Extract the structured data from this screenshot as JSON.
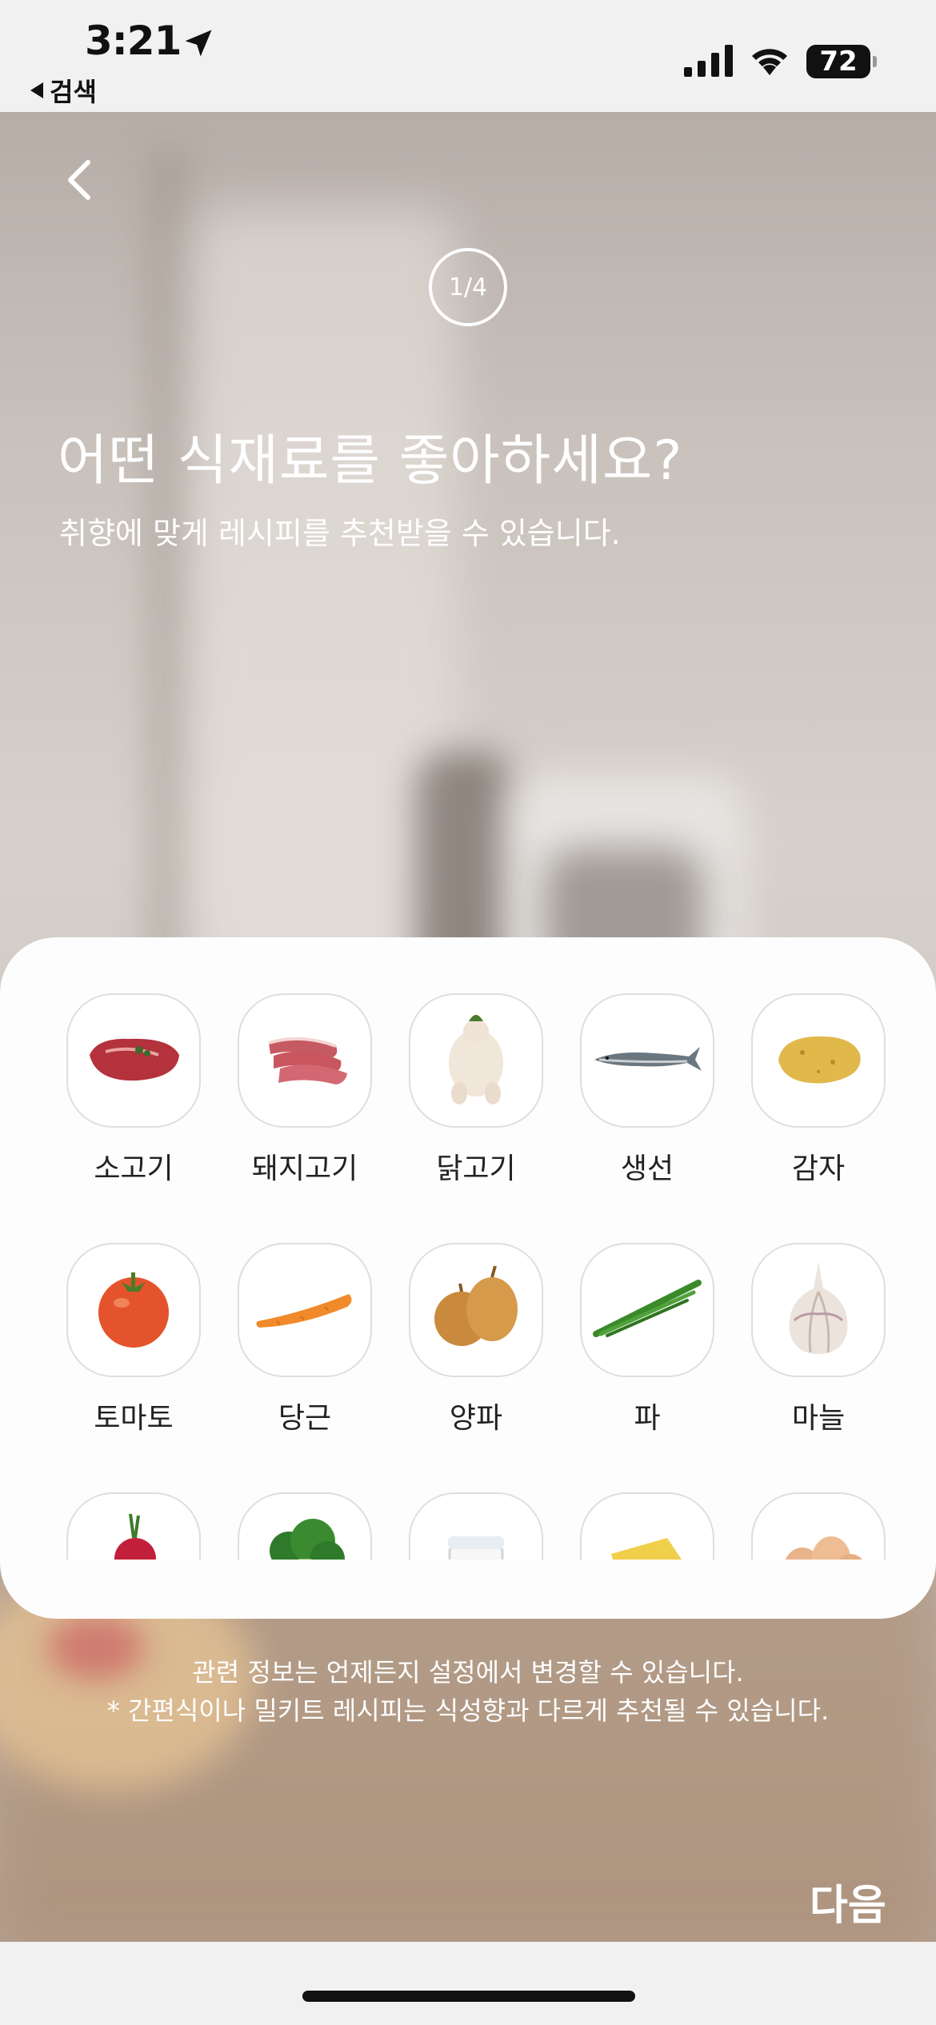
{
  "status_bar": {
    "time": "3:21",
    "back_app_label": "검색",
    "battery_level": "72"
  },
  "header": {
    "step": "1/4",
    "title": "어떤 식재료를 좋아하세요?",
    "subtitle": "취향에 맞게 레시피를 추천받을 수 있습니다."
  },
  "ingredients": [
    {
      "label": "소고기",
      "icon": "beef-icon"
    },
    {
      "label": "돼지고기",
      "icon": "pork-icon"
    },
    {
      "label": "닭고기",
      "icon": "chicken-icon"
    },
    {
      "label": "생선",
      "icon": "fish-icon"
    },
    {
      "label": "감자",
      "icon": "potato-icon"
    },
    {
      "label": "토마토",
      "icon": "tomato-icon"
    },
    {
      "label": "당근",
      "icon": "carrot-icon"
    },
    {
      "label": "양파",
      "icon": "onion-icon"
    },
    {
      "label": "파",
      "icon": "green-onion-icon"
    },
    {
      "label": "마늘",
      "icon": "garlic-icon"
    },
    {
      "label": "",
      "icon": "radish-icon"
    },
    {
      "label": "",
      "icon": "broccoli-icon"
    },
    {
      "label": "",
      "icon": "yogurt-icon"
    },
    {
      "label": "",
      "icon": "cheese-icon"
    },
    {
      "label": "",
      "icon": "egg-icon"
    }
  ],
  "footer": {
    "note_1": "관련 정보는 언제든지 설정에서 변경할 수 있습니다.",
    "note_2": "* 간편식이나 밀키트 레시피는 식성향과 다르게 추천될 수 있습니다.",
    "next_label": "다음"
  }
}
